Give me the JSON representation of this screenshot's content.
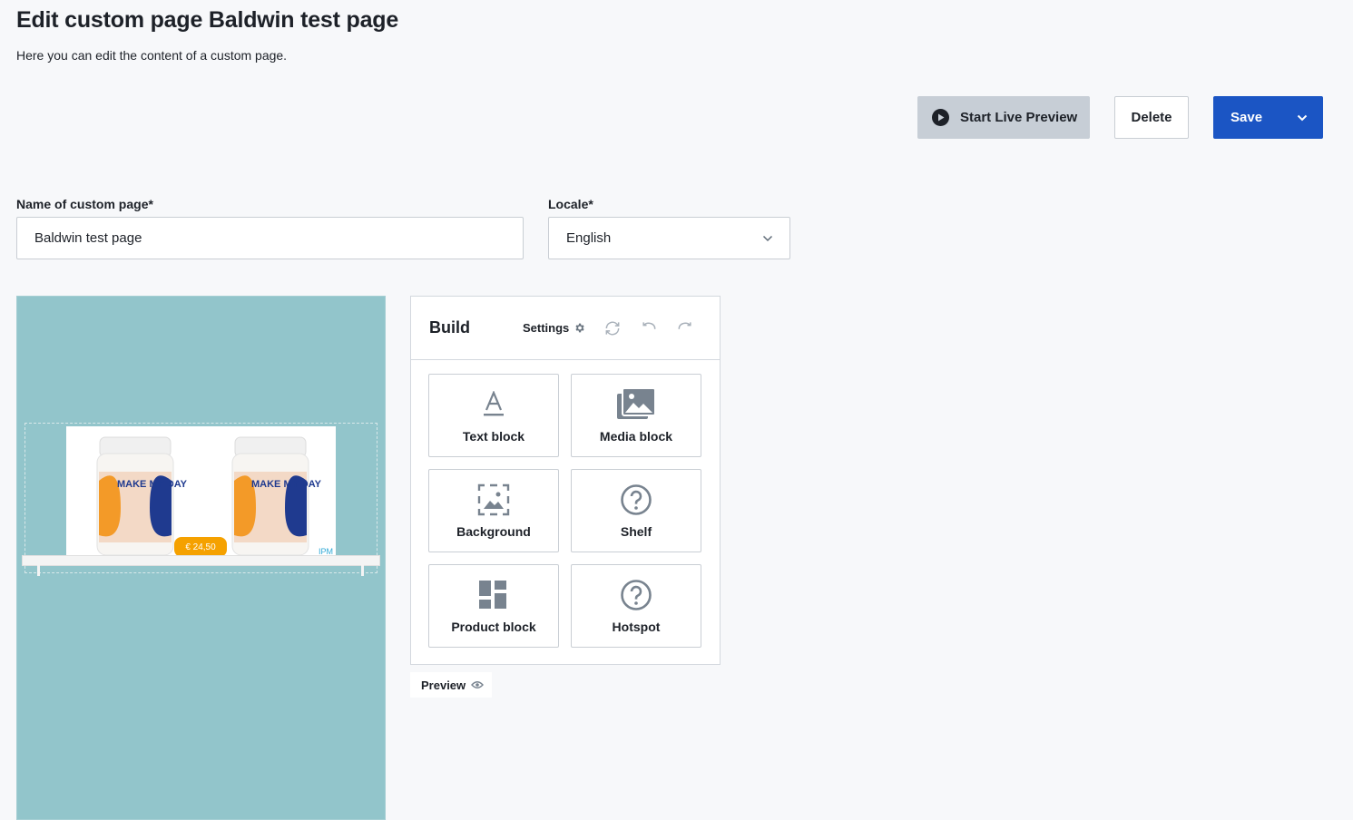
{
  "page": {
    "title": "Edit custom page Baldwin test page",
    "subtitle": "Here you can edit the content of a custom page."
  },
  "actions": {
    "live_preview_label": "Start Live Preview",
    "delete_label": "Delete",
    "save_label": "Save"
  },
  "form": {
    "name_label": "Name of custom page*",
    "name_value": "Baldwin test page",
    "locale_label": "Locale*",
    "locale_value": "English"
  },
  "canvas": {
    "background_color": "#92c5cb",
    "price_badge": "€ 24,50",
    "product_label": "MAKE MY DAY",
    "logo_text": "IPM"
  },
  "build_panel": {
    "title": "Build",
    "settings_label": "Settings",
    "blocks": [
      {
        "label": "Text block",
        "icon": "text-a-icon"
      },
      {
        "label": "Media block",
        "icon": "images-icon"
      },
      {
        "label": "Background",
        "icon": "background-image-icon"
      },
      {
        "label": "Shelf",
        "icon": "question-circle-icon"
      },
      {
        "label": "Product block",
        "icon": "dashboard-grid-icon"
      },
      {
        "label": "Hotspot",
        "icon": "question-circle-icon"
      }
    ]
  },
  "preview_toggle": {
    "label": "Preview"
  },
  "colors": {
    "primary": "#1b55c4",
    "accent_price": "#f5a100",
    "icon_gray": "#78838f"
  }
}
